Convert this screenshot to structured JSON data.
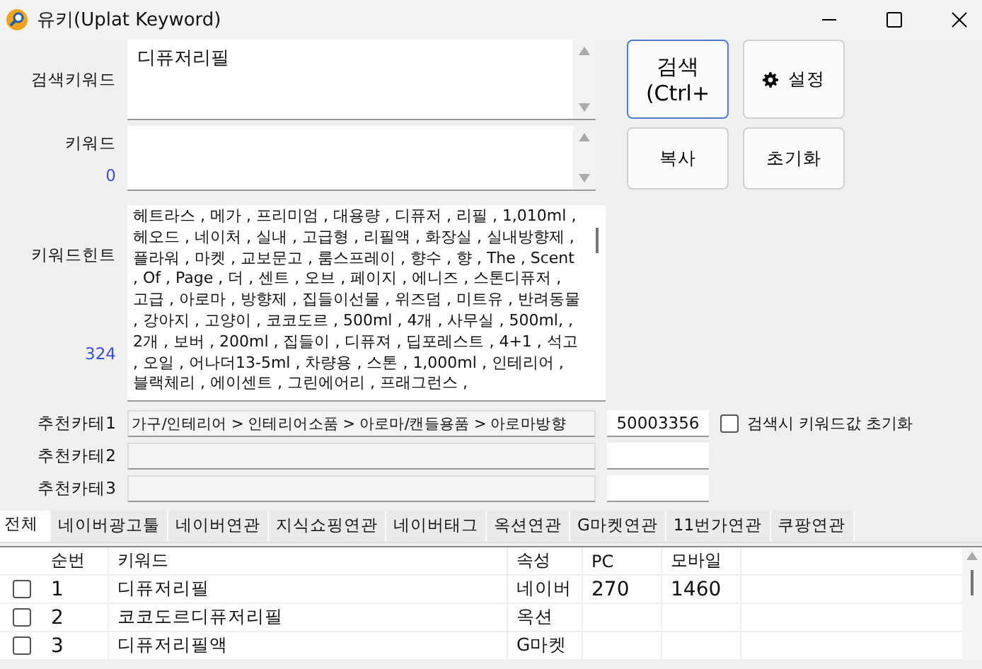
{
  "window": {
    "title": "유키(Uplat Keyword)"
  },
  "search_keyword": {
    "label": "검색키워드",
    "value": "디퓨저리필"
  },
  "keyword": {
    "label": "키워드",
    "count": "0"
  },
  "buttons": [
    {
      "kind": "search",
      "lines": [
        "검색",
        "(Ctrl+"
      ],
      "focused": true
    },
    {
      "kind": "settings",
      "lines": [
        "설정"
      ],
      "focused": false
    },
    {
      "kind": "copy",
      "lines": [
        "복사"
      ],
      "focused": false
    },
    {
      "kind": "reset",
      "lines": [
        "초기화"
      ],
      "focused": false
    }
  ],
  "keyword_hint": {
    "label": "키워드힌트",
    "count": "324",
    "text": "헤트라스 , 메가 , 프리미엄 , 대용량 , 디퓨저 , 리필 , 1,010ml , 헤오드 , 네이처 , 실내 , 고급형 , 리필액 , 화장실 , 실내방향제 , 플라워 , 마켓 , 교보문고 , 룸스프레이 , 향수 , 향 , The , Scent , Of , Page , 더 , 센트 , 오브 , 페이지 , 에니즈 , 스톤디퓨저 , 고급 , 아로마 , 방향제 , 집들이선물 , 위즈덤 , 미트유 , 반려동물 , 강아지 , 고양이 , 코코도르 , 500ml , 4개 , 사무실 , 500ml, , 2개 , 보버 , 200ml , 집들이 , 디퓨져 , 딥포레스트 , 4+1 , 석고 , 오일 , 어나더13-5ml , 차량용 , 스톤 , 1,000ml , 인테리어 , 블랙체리 , 에이센트 , 그린에어리 , 프래그런스 ,"
  },
  "categories": [
    {
      "label": "추천카테1",
      "path": "가구/인테리어 > 인테리어소품 > 아로마/캔들용품 > 아로마방향",
      "code": "50003356"
    },
    {
      "label": "추천카테2"
    },
    {
      "label": "추천카테3"
    }
  ],
  "reset_on_search": {
    "label": "검색시 키워드값 초기화",
    "checked": false
  },
  "tabs": [
    {
      "label": "전체",
      "selected": true
    },
    {
      "label": "네이버광고툴",
      "selected": false
    },
    {
      "label": "네이버연관",
      "selected": false
    },
    {
      "label": "지식쇼핑연관",
      "selected": false
    },
    {
      "label": "네이버태그",
      "selected": false
    },
    {
      "label": "옥션연관",
      "selected": false
    },
    {
      "label": "G마켓연관",
      "selected": false
    },
    {
      "label": "11번가연관",
      "selected": false
    },
    {
      "label": "쿠팡연관",
      "selected": false
    }
  ],
  "table": {
    "columns": [
      "순번",
      "키워드",
      "속성",
      "PC",
      "모바일"
    ],
    "rows": [
      {
        "checked": false,
        "cells": [
          "1",
          "디퓨저리필",
          "네이버",
          "270",
          "1460"
        ]
      },
      {
        "checked": false,
        "cells": [
          "2",
          "코코도르디퓨저리필",
          "옥션"
        ]
      },
      {
        "checked": false,
        "cells": [
          "3",
          "디퓨저리필액",
          "G마켓"
        ]
      }
    ]
  }
}
